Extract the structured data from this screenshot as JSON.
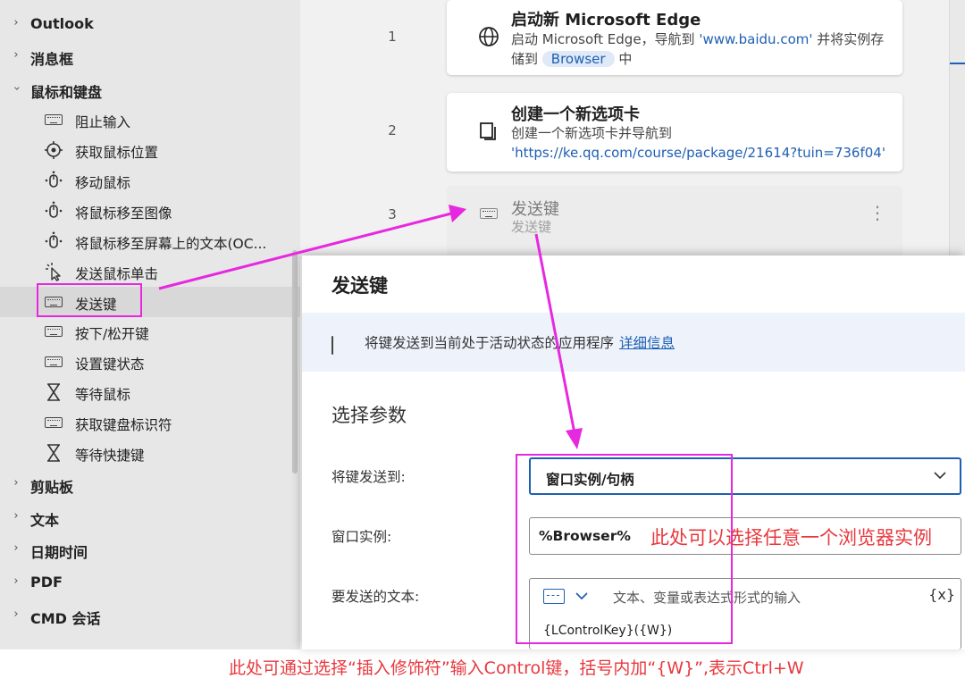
{
  "sidebar": {
    "categories_top": [
      {
        "label": "Outlook",
        "expanded": false
      },
      {
        "label": "消息框",
        "expanded": false
      },
      {
        "label": "鼠标和键盘",
        "expanded": true
      }
    ],
    "items": [
      {
        "label": "阻止输入",
        "icon": "keyboard-icon"
      },
      {
        "label": "获取鼠标位置",
        "icon": "target-icon"
      },
      {
        "label": "移动鼠标",
        "icon": "mouse-move-icon"
      },
      {
        "label": "将鼠标移至图像",
        "icon": "mouse-move-icon"
      },
      {
        "label": "将鼠标移至屏幕上的文本(OC...",
        "icon": "mouse-move-icon"
      },
      {
        "label": "发送鼠标单击",
        "icon": "mouse-click-icon"
      },
      {
        "label": "发送键",
        "icon": "keyboard-icon",
        "selected": true
      },
      {
        "label": "按下/松开键",
        "icon": "keyboard-icon"
      },
      {
        "label": "设置键状态",
        "icon": "keyboard-icon"
      },
      {
        "label": "等待鼠标",
        "icon": "hourglass-icon"
      },
      {
        "label": "获取键盘标识符",
        "icon": "keyboard-icon"
      },
      {
        "label": "等待快捷键",
        "icon": "hourglass-icon"
      }
    ],
    "categories_bottom": [
      {
        "label": "剪贴板",
        "expanded": false
      },
      {
        "label": "文本",
        "expanded": false
      },
      {
        "label": "日期时间",
        "expanded": false
      },
      {
        "label": "PDF",
        "expanded": false
      },
      {
        "label": "CMD 会话",
        "expanded": false
      }
    ]
  },
  "steps": [
    {
      "number": "1",
      "icon": "globe-icon",
      "title": "启动新 Microsoft Edge",
      "desc_prefix": "启动 Microsoft Edge，导航到 ",
      "desc_link": "'www.baidu.com'",
      "desc_mid": " 并将实例存储到 ",
      "desc_var": "Browser",
      "desc_suffix": " 中"
    },
    {
      "number": "2",
      "icon": "new-tab-icon",
      "title": "创建一个新选项卡",
      "desc_prefix": "创建一个新选项卡并导航到 ",
      "desc_link": "'https://ke.qq.com/course/package/21614?tuin=736f04'"
    },
    {
      "number": "3",
      "icon": "keyboard-icon",
      "title": "发送键",
      "desc": "发送键",
      "menu_icon": "more-vertical-icon"
    }
  ],
  "dialog": {
    "title": "发送键",
    "info_text": "将键发送到当前处于活动状态的应用程序",
    "info_link": "详细信息",
    "section": "选择参数",
    "params": [
      {
        "label": "将键发送到:",
        "value": "窗口实例/句柄"
      },
      {
        "label": "窗口实例:",
        "value": "%Browser%"
      },
      {
        "label": "要发送的文本:",
        "placeholder": "文本、变量或表达式形式的输入",
        "value": "{LControlKey}({W})",
        "fx": "{x}"
      }
    ]
  },
  "annotations": {
    "window_note": "此处可以选择任意一个浏览器实例",
    "bottom_note": "此处可通过选择“插入修饰符”输入Control键，括号内加“{W}”,表示Ctrl+W",
    "color": "#e629e0",
    "text_color": "#e8383d"
  },
  "colors": {
    "accent": "#1e5fb4",
    "sidebar_bg": "#e7e7e7",
    "workspace_bg": "#f1f1f1"
  }
}
